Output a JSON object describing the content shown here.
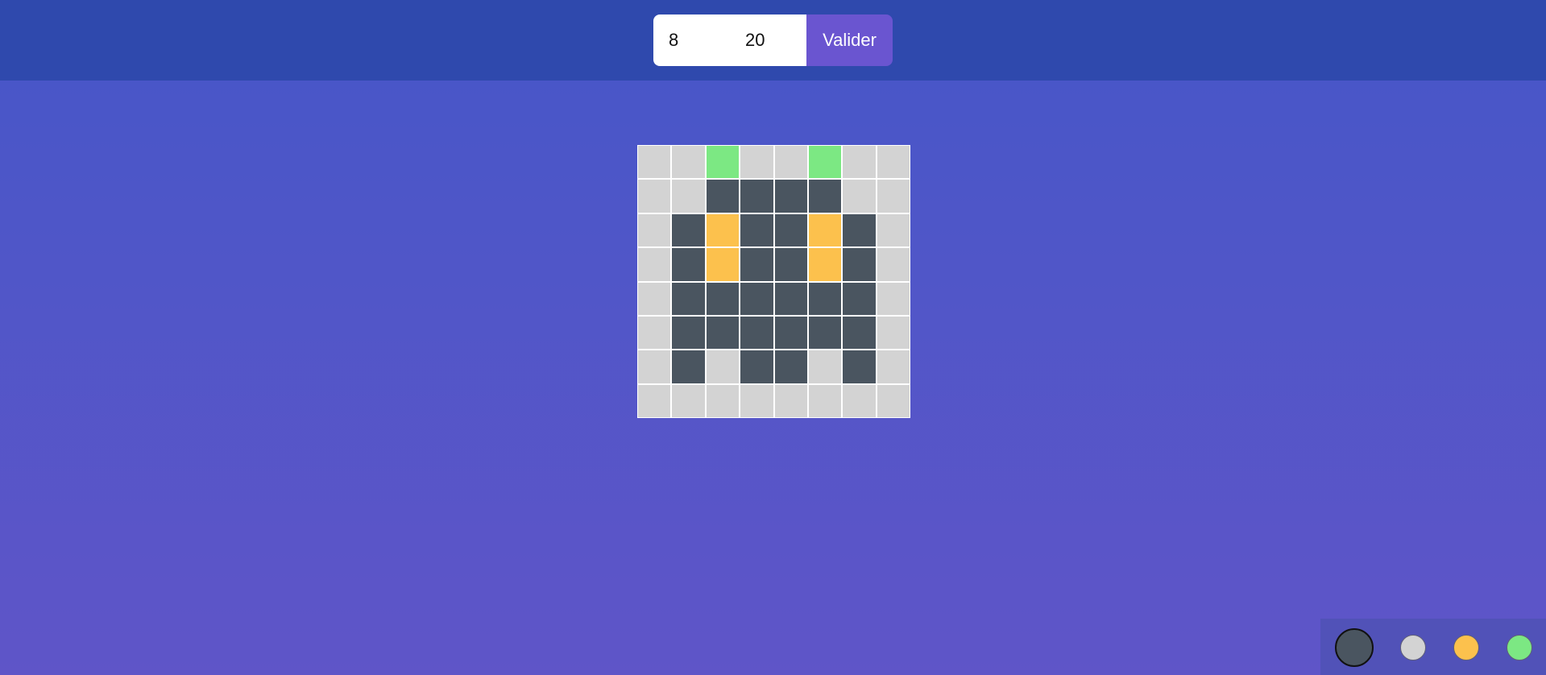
{
  "form": {
    "size_value": "8",
    "pixel_value": "20",
    "submit_label": "Valider"
  },
  "colors": {
    "topbar": "#2f49ad",
    "submit": "#6a55d0",
    "dark": "#4a5560",
    "light": "#d3d3d3",
    "orange": "#fcc14d",
    "green": "#7ce883"
  },
  "grid": {
    "columns": 8,
    "rows": [
      [
        "light",
        "light",
        "green",
        "light",
        "light",
        "green",
        "light",
        "light"
      ],
      [
        "light",
        "light",
        "dark",
        "dark",
        "dark",
        "dark",
        "light",
        "light"
      ],
      [
        "light",
        "dark",
        "orange",
        "dark",
        "dark",
        "orange",
        "dark",
        "light"
      ],
      [
        "light",
        "dark",
        "orange",
        "dark",
        "dark",
        "orange",
        "dark",
        "light"
      ],
      [
        "light",
        "dark",
        "dark",
        "dark",
        "dark",
        "dark",
        "dark",
        "light"
      ],
      [
        "light",
        "dark",
        "dark",
        "dark",
        "dark",
        "dark",
        "dark",
        "light"
      ],
      [
        "light",
        "dark",
        "light",
        "dark",
        "dark",
        "light",
        "dark",
        "light"
      ],
      [
        "light",
        "light",
        "light",
        "light",
        "light",
        "light",
        "light",
        "light"
      ]
    ]
  },
  "palette": {
    "selected": "dark",
    "swatches": [
      "dark",
      "light",
      "orange",
      "green"
    ]
  }
}
